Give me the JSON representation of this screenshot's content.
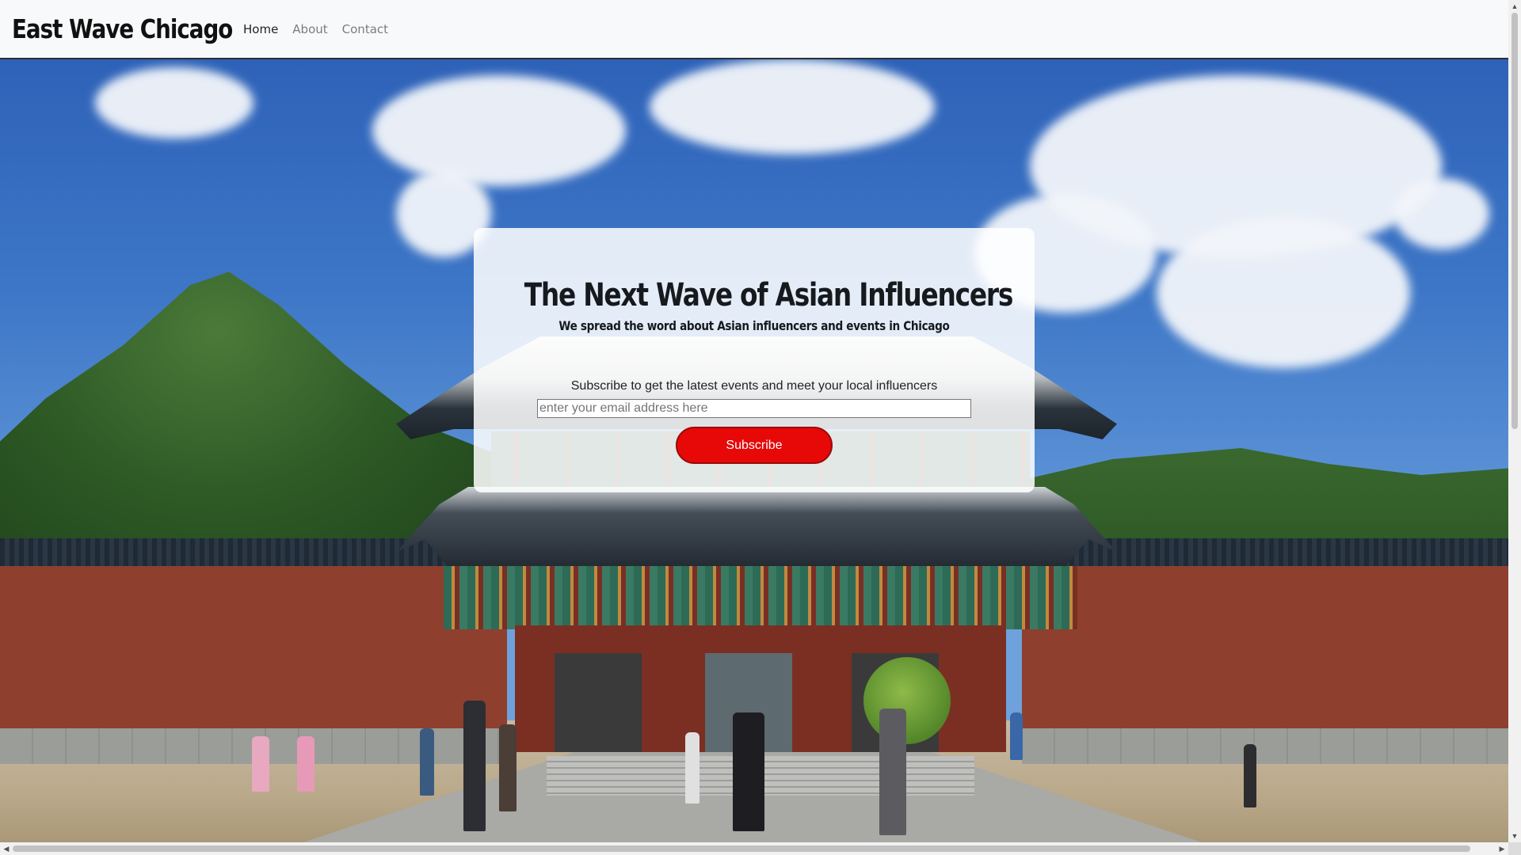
{
  "navbar": {
    "brand": "East Wave Chicago",
    "links": [
      {
        "label": "Home",
        "active": true
      },
      {
        "label": "About",
        "active": false
      },
      {
        "label": "Contact",
        "active": false
      }
    ]
  },
  "hero": {
    "title": "The Next Wave of Asian Influencers",
    "tagline": "We spread the word about Asian influencers and events in Chicago",
    "subscribe_prompt": "Subscribe to get the latest events and meet your local influencers",
    "email_placeholder": "enter your email address here",
    "subscribe_label": "Subscribe"
  },
  "colors": {
    "navbar_bg": "#f8f9fa",
    "subscribe_button": "#e70808",
    "card_bg": "rgba(255,255,255,0.86)"
  },
  "icons": {
    "scroll_up": "triangle-up",
    "scroll_down": "triangle-down",
    "scroll_left": "triangle-left",
    "scroll_right": "triangle-right"
  }
}
